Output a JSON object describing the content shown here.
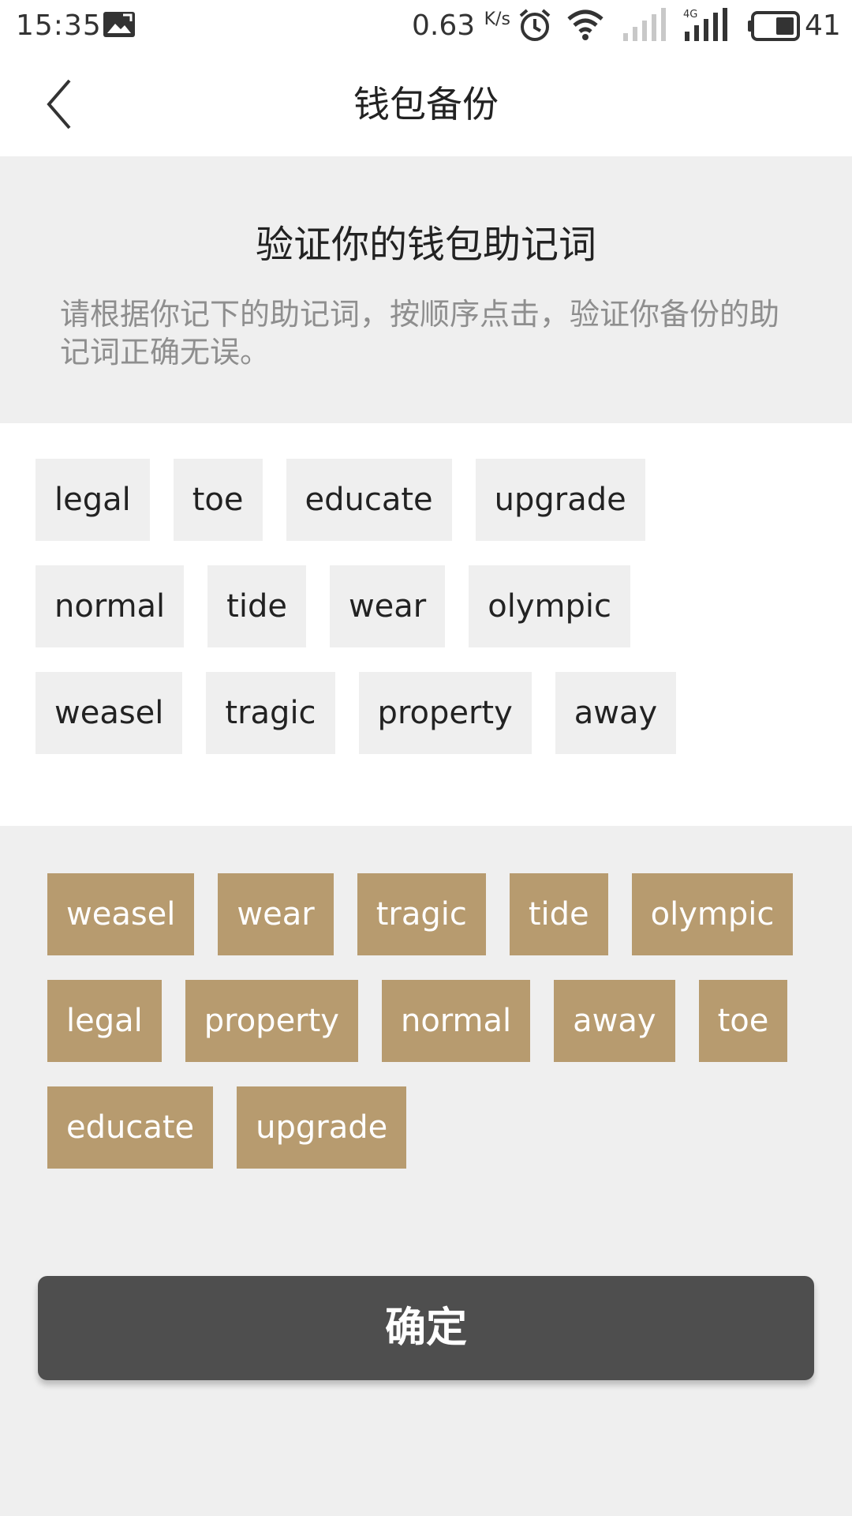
{
  "status_bar": {
    "time": "15:35",
    "network_speed": "0.63",
    "network_speed_unit": "K/s",
    "battery_level": "41",
    "icons": [
      "image-notification-icon",
      "alarm-icon",
      "wifi-icon",
      "signal-empty-icon",
      "signal-4g-icon",
      "battery-icon"
    ]
  },
  "nav": {
    "title": "钱包备份",
    "back_icon": "back-chevron-icon"
  },
  "instruction": {
    "title": "验证你的钱包助记词",
    "description": "请根据你记下的助记词，按顺序点击，验证你备份的助记词正确无误。"
  },
  "selected_words": [
    "legal",
    "toe",
    "educate",
    "upgrade",
    "normal",
    "tide",
    "wear",
    "olympic",
    "weasel",
    "tragic",
    "property",
    "away"
  ],
  "pool_words": [
    "weasel",
    "wear",
    "tragic",
    "tide",
    "olympic",
    "legal",
    "property",
    "normal",
    "away",
    "toe",
    "educate",
    "upgrade"
  ],
  "confirm_label": "确定",
  "colors": {
    "accent_chip": "#b79b6f",
    "button_dark": "#4e4e4e",
    "selected_chip_bg": "#efefef"
  }
}
